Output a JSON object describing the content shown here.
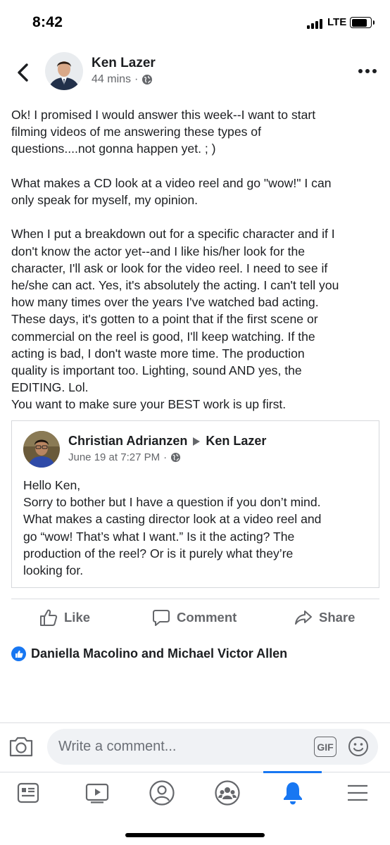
{
  "status_bar": {
    "time": "8:42",
    "network": "LTE"
  },
  "post": {
    "author": "Ken Lazer",
    "time_ago": "44 mins",
    "separator": "·",
    "body_lines": [
      "Ok! I promised I would answer this week--I want to start",
      "filming videos of me answering these types of",
      "questions....not gonna happen yet. ; )",
      "",
      "What makes a CD look at a video reel and go \"wow!\" I can",
      "only speak for myself, my opinion.",
      "",
      "When I put a breakdown out for a specific character and if I",
      "don't know the actor yet--and I like his/her look for the",
      "character, I'll ask or look for the video reel. I need to see if",
      "he/she can act. Yes, it's absolutely the acting. I can't tell you",
      "how many times over the years I've watched bad acting.",
      "These days, it's gotten to a point that if the first scene or",
      "commercial on the reel is good, I'll keep watching. If the",
      "acting is bad, I don't waste more time. The production",
      "quality is important too. Lighting, sound AND yes, the",
      "EDITING. Lol.",
      "You want to make sure your BEST work is up first."
    ]
  },
  "shared_post": {
    "author": "Christian Adrianzen",
    "target": "Ken Lazer",
    "date": "June 19 at 7:27 PM",
    "separator": "·",
    "body_lines": [
      "Hello Ken,",
      "Sorry to bother but I have a question if you don’t mind.",
      "What makes a casting director look at a video reel and",
      "go “wow! That’s what I want.” Is it the acting? The",
      "production of the reel? Or is it purely what they’re",
      "looking for."
    ]
  },
  "actions": {
    "like": "Like",
    "comment": "Comment",
    "share": "Share"
  },
  "reactions": {
    "text": "Daniella Macolino and Michael Victor Allen"
  },
  "comment_bar": {
    "placeholder": "Write a comment...",
    "gif_label": "GIF"
  },
  "tabs": [
    {
      "icon": "news-feed-icon",
      "active": false
    },
    {
      "icon": "watch-icon",
      "active": false
    },
    {
      "icon": "profile-icon",
      "active": false
    },
    {
      "icon": "groups-icon",
      "active": false
    },
    {
      "icon": "notifications-icon",
      "active": true
    },
    {
      "icon": "menu-icon",
      "active": false
    }
  ],
  "colors": {
    "accent": "#1877f2",
    "secondary_text": "#65676b",
    "primary_text": "#1c1e21"
  }
}
